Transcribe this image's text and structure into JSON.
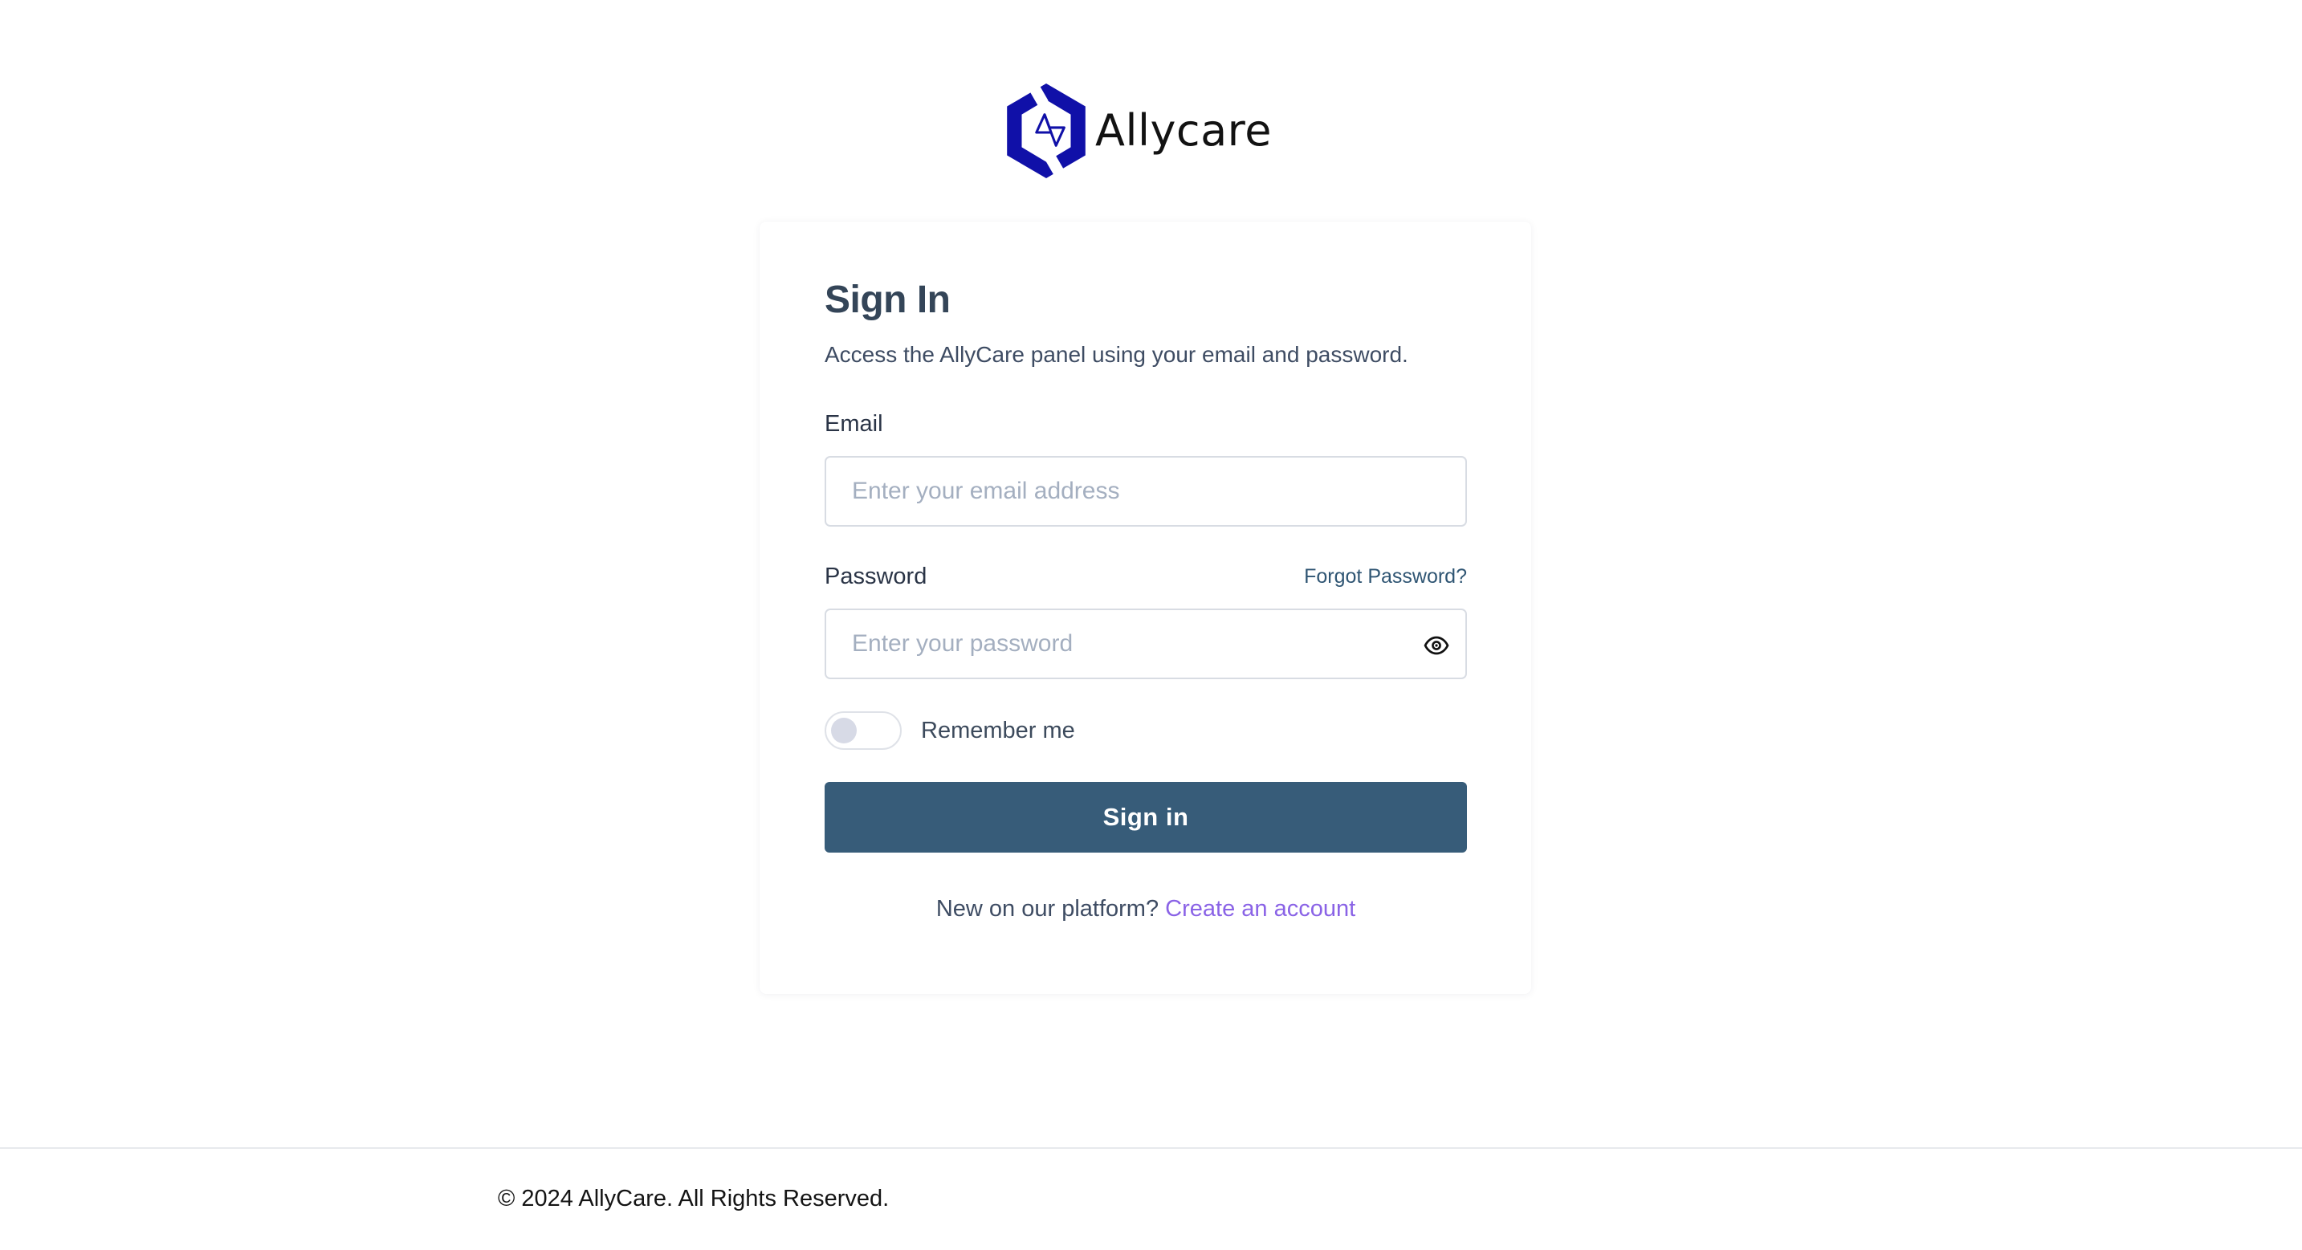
{
  "brand": {
    "name": "Allycare",
    "logo_icon": "allycare-hexagon-logo-icon",
    "logo_color": "#1010a8"
  },
  "signin": {
    "title": "Sign In",
    "subtitle": "Access the AllyCare panel using your email and password.",
    "email": {
      "label": "Email",
      "placeholder": "Enter your email address",
      "value": ""
    },
    "password": {
      "label": "Password",
      "placeholder": "Enter your password",
      "value": "",
      "forgot_label": "Forgot Password?",
      "toggle_icon": "eye-icon"
    },
    "remember": {
      "label": "Remember me",
      "checked": false
    },
    "submit_label": "Sign in",
    "signup_prompt": "New on our platform?",
    "signup_link": "Create an account"
  },
  "footer": {
    "copyright": "© 2024 AllyCare. All Rights Reserved."
  },
  "colors": {
    "primary_button": "#375c79",
    "link_accent": "#8a63e6",
    "forgot_link": "#2f5573",
    "heading": "#344558"
  }
}
